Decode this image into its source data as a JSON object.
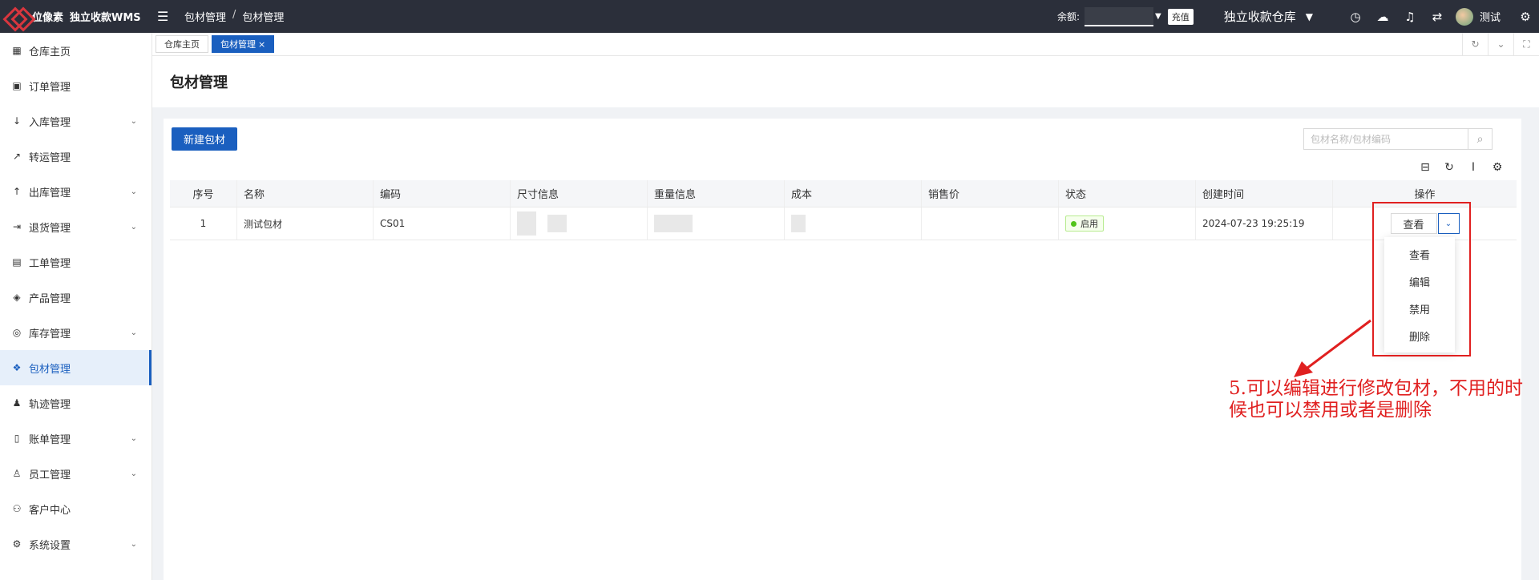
{
  "topbar": {
    "logo_text": "位像素",
    "app_name": "独立收款WMS",
    "breadcrumb": [
      "包材管理",
      "包材管理"
    ],
    "breadcrumb_sep": "/",
    "balance_label": "余额:",
    "recharge_label": "充值",
    "warehouse": "独立收款仓库",
    "user_name": "测试",
    "icons": [
      "menu-fold-icon",
      "clock-icon",
      "cloud-icon",
      "bell-icon",
      "translate-icon",
      "gear-icon"
    ]
  },
  "sidebar": {
    "items": [
      {
        "label": "仓库主页",
        "icon": "grid-icon",
        "caret": false
      },
      {
        "label": "订单管理",
        "icon": "order-icon",
        "caret": false
      },
      {
        "label": "入库管理",
        "icon": "arrow-down-icon",
        "caret": true
      },
      {
        "label": "转运管理",
        "icon": "transfer-icon",
        "caret": false
      },
      {
        "label": "出库管理",
        "icon": "arrow-up-icon",
        "caret": true
      },
      {
        "label": "退货管理",
        "icon": "return-icon",
        "caret": true
      },
      {
        "label": "工单管理",
        "icon": "ticket-icon",
        "caret": false
      },
      {
        "label": "产品管理",
        "icon": "product-icon",
        "caret": false
      },
      {
        "label": "库存管理",
        "icon": "inventory-icon",
        "caret": true
      },
      {
        "label": "包材管理",
        "icon": "dropbox-icon",
        "caret": false,
        "active": true
      },
      {
        "label": "轨迹管理",
        "icon": "track-icon",
        "caret": false
      },
      {
        "label": "账单管理",
        "icon": "bill-icon",
        "caret": true
      },
      {
        "label": "员工管理",
        "icon": "user-icon",
        "caret": true
      },
      {
        "label": "客户中心",
        "icon": "customer-icon",
        "caret": false
      },
      {
        "label": "系统设置",
        "icon": "settings-icon",
        "caret": true
      }
    ]
  },
  "tabs": [
    {
      "label": "仓库主页",
      "active": false
    },
    {
      "label": "包材管理",
      "active": true,
      "close": "×"
    }
  ],
  "page": {
    "title": "包材管理",
    "new_button": "新建包材",
    "search_placeholder": "包材名称/包材编码"
  },
  "table": {
    "headers": [
      "序号",
      "名称",
      "编码",
      "尺寸信息",
      "重量信息",
      "成本",
      "销售价",
      "状态",
      "创建时间",
      "操作"
    ],
    "rows": [
      {
        "index": "1",
        "name": "测试包材",
        "code": "CS01",
        "status": "启用",
        "created": "2024-07-23 19:25:19",
        "action": "查看"
      }
    ]
  },
  "dropdown": {
    "items": [
      "查看",
      "编辑",
      "禁用",
      "删除"
    ]
  },
  "annotation": {
    "text": "5.可以编辑进行修改包材，不用的时候也可以禁用或者是删除",
    "color": "#e02020"
  },
  "colors": {
    "primary": "#1a5fbf",
    "topbar_bg": "#2b2f3a",
    "status_green": "#52c41a"
  }
}
